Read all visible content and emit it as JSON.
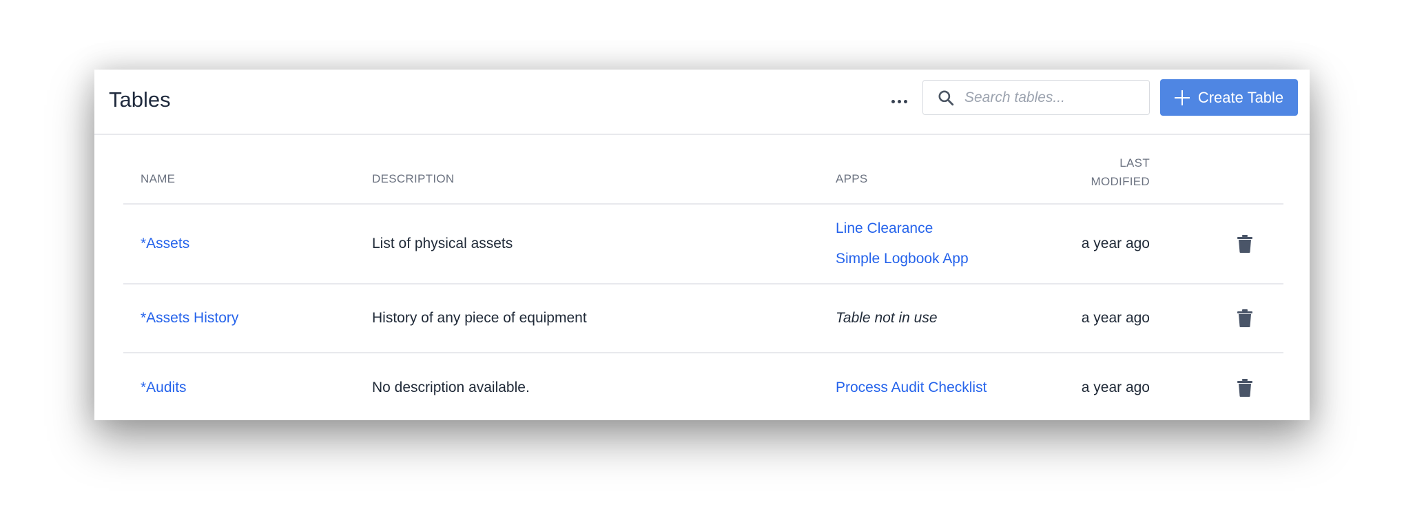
{
  "header": {
    "title": "Tables",
    "more_label": "More options",
    "search_placeholder": "Search tables...",
    "search_value": "",
    "create_label": "Create Table"
  },
  "table": {
    "columns": {
      "name": "Name",
      "description": "Description",
      "apps": "Apps",
      "last_modified_line1": "Last",
      "last_modified_line2": "Modified"
    },
    "rows": [
      {
        "name": "*Assets",
        "description": "List of physical assets",
        "apps": [
          "Line Clearance",
          "Simple Logbook App"
        ],
        "apps_status": "",
        "last_modified": "a year ago"
      },
      {
        "name": "*Assets History",
        "description": "History of any piece of equipment",
        "apps": [],
        "apps_status": "Table not in use",
        "last_modified": "a year ago"
      },
      {
        "name": "*Audits",
        "description": "No description available.",
        "apps": [
          "Process Audit Checklist"
        ],
        "apps_status": "",
        "last_modified": "a year ago"
      }
    ]
  },
  "icons": {
    "more": "more-horizontal-icon",
    "search": "search-icon",
    "create": "plus-icon",
    "delete": "trash-icon"
  },
  "colors": {
    "accent": "#4f86e3",
    "link": "#2563eb",
    "icon": "#4a5568"
  }
}
